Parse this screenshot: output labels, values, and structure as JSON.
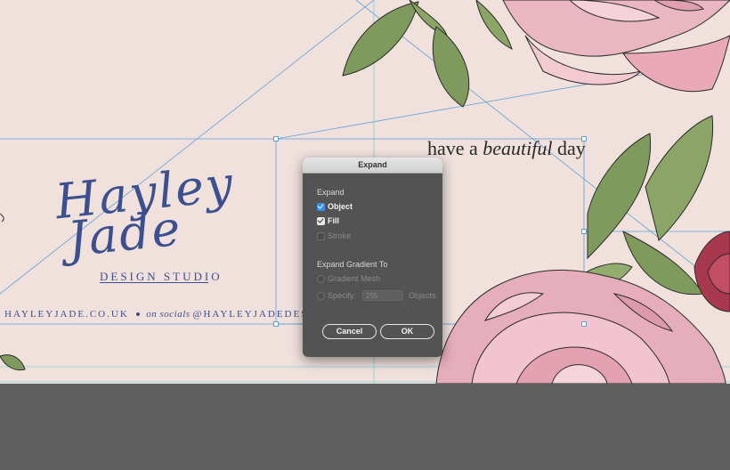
{
  "artboard": {
    "logo": {
      "line1": "Hayley",
      "line2": "Jade",
      "tagline": "DESIGN STUDIO"
    },
    "footer": {
      "website": "HAYLEYJADE.CO.UK",
      "socials_label": "on socials",
      "handle": "@HAYLEYJADEDESIGN"
    },
    "headline": {
      "pre": "have a ",
      "emph": "beautiful",
      "post": " day"
    },
    "colors": {
      "background": "#f0e1dd",
      "brand_blue": "#3c4f8f",
      "guide": "#5fa0d9",
      "pasteboard": "#5f5f5f"
    }
  },
  "dialog": {
    "title": "Expand",
    "expand_section": "Expand",
    "object_label": "Object",
    "object_checked": true,
    "fill_label": "Fill",
    "fill_checked": true,
    "stroke_label": "Stroke",
    "stroke_checked": false,
    "gradient_section": "Expand Gradient To",
    "gradient_mesh_label": "Gradient Mesh",
    "specify_label": "Specify:",
    "specify_value": "255",
    "objects_label": "Objects",
    "cancel_label": "Cancel",
    "ok_label": "OK"
  }
}
